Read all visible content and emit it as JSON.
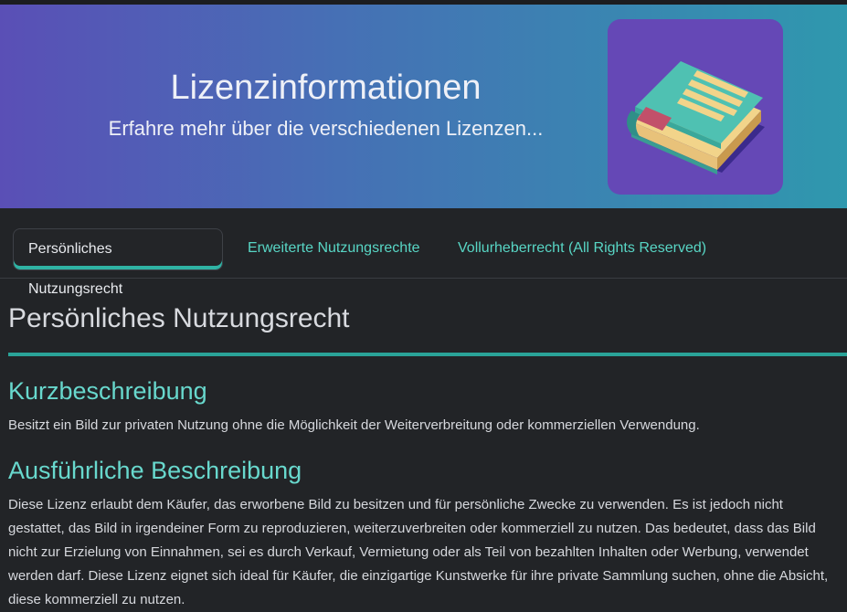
{
  "header": {
    "title": "Lizenzinformationen",
    "subtitle": "Erfahre mehr über die verschiedenen Lizenzen...",
    "illustration": "book-icon",
    "gradient_start": "#5a4fb6",
    "gradient_end": "#2f98ae",
    "card_color": "#6548b6"
  },
  "tabs": [
    {
      "label": "Persönliches Nutzungsrecht",
      "active": true
    },
    {
      "label": "Erweiterte Nutzungsrechte",
      "active": false
    },
    {
      "label": "Vollurheberrecht (All Rights Reserved)",
      "active": false
    }
  ],
  "content": {
    "title": "Persönliches Nutzungsrecht",
    "short_heading": "Kurzbeschreibung",
    "short_text": "Besitzt ein Bild zur privaten Nutzung ohne die Möglichkeit der Weiterverbreitung oder kommerziellen Verwendung.",
    "long_heading": "Ausführliche Beschreibung",
    "long_text": "Diese Lizenz erlaubt dem Käufer, das erworbene Bild zu besitzen und für persönliche Zwecke zu verwenden. Es ist jedoch nicht gestattet, das Bild in irgendeiner Form zu reproduzieren, weiterzuverbreiten oder kommerziell zu nutzen. Das bedeutet, dass das Bild nicht zur Erzielung von Einnahmen, sei es durch Verkauf, Vermietung oder als Teil von bezahlten Inhalten oder Werbung, verwendet werden darf. Diese Lizenz eignet sich ideal für Käufer, die einzigartige Kunstwerke für ihre private Sammlung suchen, ohne die Absicht, diese kommerziell zu nutzen."
  },
  "colors": {
    "accent": "#2fb3a4",
    "heading": "#68d8cd",
    "background": "#222427"
  }
}
